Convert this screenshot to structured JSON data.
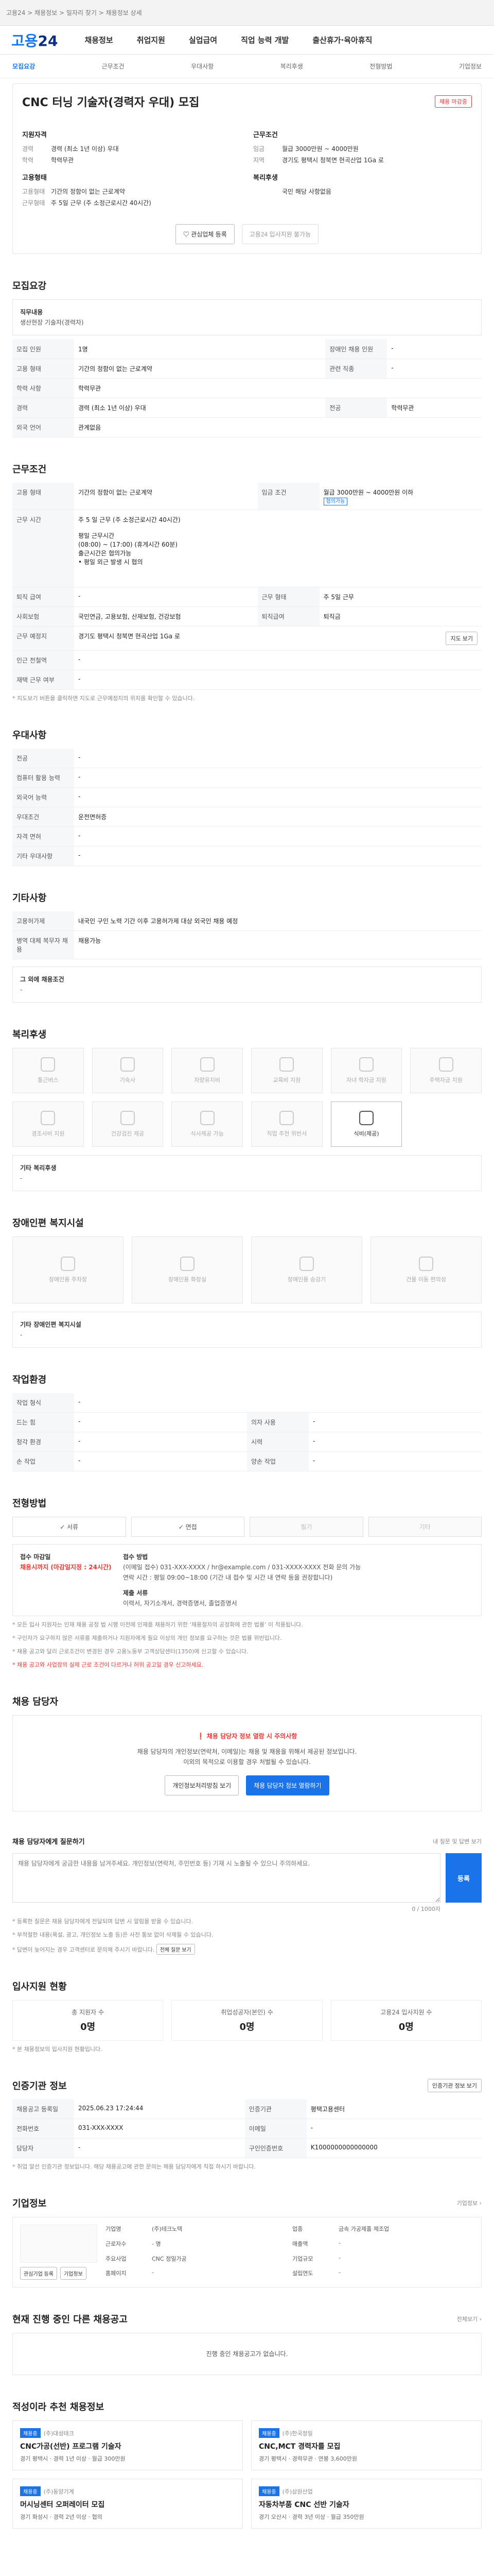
{
  "window_title": "고용24 > 채용정보 > 일자리 찾기 > 채용정보 상세",
  "brand": {
    "logo": "고용",
    "logo_num": "24"
  },
  "gnb": [
    "채용정보",
    "취업지원",
    "실업급여",
    "직업 능력 개발",
    "출산휴가·육아휴직"
  ],
  "subnav": [
    {
      "label": "모집요강",
      "active": true
    },
    {
      "label": "근무조건",
      "active": false
    },
    {
      "label": "우대사항",
      "active": false
    },
    {
      "label": "복리후생",
      "active": false
    },
    {
      "label": "전형방법",
      "active": false
    },
    {
      "label": "기업정보",
      "active": false
    }
  ],
  "job": {
    "title": "CNC 터닝 기술자(경력자 우대) 모집",
    "badge": "채용 마감중",
    "left_head": "지원자격",
    "left_rows": [
      {
        "k": "경력",
        "v": "경력 (최소 1년 이상) 우대"
      },
      {
        "k": "학력",
        "v": "학력무관"
      }
    ],
    "left_head2": "고용형태",
    "left_rows2": [
      {
        "k": "고용형태",
        "v": "기간의 정함이 없는 근로계약"
      },
      {
        "k": "근무형태",
        "v": "주 5일 근무 (주 소정근로시간 40시간)"
      }
    ],
    "right_head": "근무조건",
    "right_rows": [
      {
        "k": "임금",
        "v": "월급 3000만원 ~ 4000만원"
      },
      {
        "k": "지역",
        "v": "경기도 평택시 청북면 현곡산업 1Ga 로"
      }
    ],
    "right_head2": "복리후생",
    "right_rows2": [
      {
        "k": "",
        "v": "국민 해당 사항없음"
      }
    ],
    "btn_apply": "관심업체 등록",
    "btn_scrap": "고용24 입사지원 불가능"
  },
  "recruit": {
    "title": "모집요강",
    "desc_label": "직무내용",
    "desc": "생산현장 기술자(경력자)",
    "rows": [
      {
        "k1": "모집 인원",
        "v1": "1명",
        "k2": "장애인 채용 인원",
        "v2": "-"
      },
      {
        "k1": "고용 형태",
        "v1": "기간의 정함이 없는 근로계약",
        "k2": "관련 직종",
        "v2": "-"
      },
      {
        "k1": "학력 사항",
        "v1": "학력무관",
        "k2": "",
        "v2": ""
      },
      {
        "k1": "경력",
        "v1": "경력 (최소 1년 이상) 우대",
        "k2": "전공",
        "v2": "학력무관"
      },
      {
        "k1": "외국 언어",
        "v1": "관계없음",
        "k2": "",
        "v2": ""
      }
    ]
  },
  "condition": {
    "title": "근무조건",
    "rows": [
      {
        "k1": "고용 형태",
        "v1": "기간의 정함이 없는 근로계약",
        "k2": "임금 조건",
        "v2": "월급 3000만원 ~ 4000만원 이하",
        "tag": "협의가능"
      },
      {
        "k1": "근무 시간",
        "v1": "주 5 일 근무 (주 소정근로시간 40시간)\n\n평일 근무시간\n(08:00) ~ (17:00) (휴게시간 60분)\n출근시간은 협의가능\n• 평일 외근 발생 시 협의",
        "k2": "",
        "v2": ""
      },
      {
        "k1": "퇴직 급여",
        "v1": "-",
        "k2": "근무 형태",
        "v2": "주 5일 근무"
      },
      {
        "k1": "사회보험",
        "v1": "국민연금, 고용보험, 산재보험, 건강보험",
        "k2": "퇴직급여",
        "v2": "퇴직금"
      },
      {
        "k1": "근무 예정지",
        "v1": "경기도 평택시 청북면 현곡산업 1Ga 로",
        "k2": "",
        "v2": ""
      },
      {
        "k1": "인근 전철역",
        "v1": "-",
        "k2": "",
        "v2": ""
      },
      {
        "k1": "재택 근무 여부",
        "v1": "-",
        "k2": "",
        "v2": ""
      }
    ],
    "map_btn": "지도 보기",
    "note": "* 지도보기 버튼을 클릭하면 지도로 근무예정지의 위치를 확인할 수 있습니다."
  },
  "preference": {
    "title": "우대사항",
    "rows": [
      {
        "k": "전공",
        "v": "-"
      },
      {
        "k": "컴퓨터 활용 능력",
        "v": "-"
      },
      {
        "k": "외국어 능력",
        "v": "-"
      },
      {
        "k": "우대조건",
        "v": "운전면허증"
      },
      {
        "k": "자격 면허",
        "v": "-"
      },
      {
        "k": "기타 우대사항",
        "v": "-"
      }
    ]
  },
  "etc": {
    "title": "기타사항",
    "rows": [
      {
        "k": "고용허가제",
        "v": "내국인 구인 노력 기간 이후 고용허가제 대상 외국인 채용 예정"
      },
      {
        "k": "병역 대체 복무자 채용",
        "v": "채용가능"
      }
    ],
    "other_label": "그 외에 채용조건",
    "other_value": "-"
  },
  "welfare": {
    "title": "복리후생",
    "items": [
      {
        "label": "통근버스",
        "on": false
      },
      {
        "label": "기숙사",
        "on": false
      },
      {
        "label": "차량유지비",
        "on": false
      },
      {
        "label": "교육비 지원",
        "on": false
      },
      {
        "label": "자녀 학자금 지원",
        "on": false
      },
      {
        "label": "주택자금 지원",
        "on": false
      },
      {
        "label": "경조사비 지원",
        "on": false
      },
      {
        "label": "건강검진 제공",
        "on": false
      },
      {
        "label": "식사제공 가능",
        "on": false
      },
      {
        "label": "직업 추천 위반서",
        "on": false
      },
      {
        "label": "식비(제공)",
        "on": true
      }
    ],
    "other_label": "기타 복리후생",
    "other_value": "-"
  },
  "disability": {
    "title": "장애인편 복지시설",
    "items": [
      "장애인용 주차장",
      "장애인용 화장실",
      "장애인용 승강기",
      "건물 이동 편의성"
    ],
    "other_label": "기타 장애인편 복지시설",
    "other_value": "-"
  },
  "work_env": {
    "title": "작업환경",
    "rows": [
      {
        "k1": "작업 형식",
        "v1": "-",
        "k2": "",
        "v2": ""
      },
      {
        "k1": "드는 힘",
        "v1": "-",
        "k2": "의자 사용",
        "v2": "-"
      },
      {
        "k1": "청각 환경",
        "v1": "-",
        "k2": "시력",
        "v2": "-"
      },
      {
        "k1": "손 작업",
        "v1": "-",
        "k2": "양손 작업",
        "v2": "-"
      }
    ]
  },
  "process": {
    "title": "전형방법",
    "methods": [
      {
        "label": "서류",
        "on": true
      },
      {
        "label": "면접",
        "on": true
      },
      {
        "label": "필기",
        "on": false
      },
      {
        "label": "기타",
        "on": false
      }
    ],
    "deadline_label": "접수 마감일",
    "deadline_value": "채용시까지 (마감일지정 : 24시간)",
    "apply_label": "접수 방법",
    "apply_value": "(이메일 접수) 031-XXX-XXXX / hr@example.com / 031-XXXX-XXXX 전화 문의 가능\n연락 시간 : 평일 09:00~18:00 (기간 내 접수 및 시간 내 연락 등을 권장합니다)",
    "doc_label": "제출 서류",
    "doc_value": "이력서, 자기소개서, 경력증명서, 졸업증명서",
    "notes": [
      "* 모든 입사 지원자는 인재 채용 공정 법 시행 이전에 인재를 채용하기 위한 ‘채용절차의 공정화에 관한 법률’ 이 적용됩니다.",
      "* 구인자가 요구하지 않은 서류를 제출하거나 지원자에게 필요 이상의 개인 정보를 요구하는 것은 법률 위반입니다.",
      "* 채용 공고와 달리 근로조건이 변경된 경우 고용노동부 고객상담센터(1350)에 신고할 수 있습니다."
    ],
    "red_note": "* 채용 공고와 사업장의 실제 근로 조건이 다르거나 허위 공고일 경우 신고하세요."
  },
  "contact": {
    "title": "채용 담당자",
    "msg_title": "채용 담당자 정보 열람 시 주의사항",
    "msg_line1": "채용 담당자의 개인정보(연락처, 이메일)는 채용 및 채용을 위해서 제공된 정보입니다.",
    "msg_line2": "이외의 목적으로 이용할 경우 처벌될 수 있습니다.",
    "btn_check": "개인정보처리방침 보기",
    "btn_view": "채용 담당자 정보 열람하기"
  },
  "qna": {
    "title": "채용 담당자에게 질문하기",
    "counter_note": "내 질문 및 답변 보기",
    "placeholder": "채용 담당자에게 궁금한 내용을 남겨주세요. 개인정보(연락처, 주민번호 등) 기재 시 노출될 수 있으니 주의하세요.",
    "submit": "등록",
    "char_count": "0 / 1000자",
    "notes": [
      "* 등록한 질문은 채용 담당자에게 전달되며 답변 시 알림을 받을 수 있습니다.",
      "* 부적절한 내용(욕설, 광고, 개인정보 노출 등)은 사전 통보 없이 삭제될 수 있습니다.",
      "* 답변이 늦어지는 경우 고객센터로 문의해 주시기 바랍니다."
    ],
    "extra_btn": "전체 질문 보기"
  },
  "status": {
    "title": "입사지원 현황",
    "items": [
      {
        "label": "총 지원자 수",
        "value": "0명"
      },
      {
        "label": "취업성공자(본인) 수",
        "value": "0명"
      },
      {
        "label": "고용24 입사지원 수",
        "value": "0명"
      }
    ],
    "note": "* 본 채용정보의 입사지원 현황입니다."
  },
  "manager": {
    "title": "인증기관 정보",
    "btn_share": "인증기관 정보 보기",
    "rows": [
      {
        "k1": "채용공고 등록일",
        "v1": "2025.06.23 17:24:44",
        "k2": "인증기관",
        "v2": "평택고용센터"
      },
      {
        "k1": "전화번호",
        "v1": "031-XXX-XXXX",
        "k2": "이메일",
        "v2": "-"
      },
      {
        "k1": "담당자",
        "v1": "-",
        "k2": "구인인증번호",
        "v2": "K1000000000000000"
      }
    ],
    "notes": [
      "* 취업 알선 인증기관 정보입니다. 해당 채용공고에 관한 문의는 채용 담당자에게 직접 하시기 바랍니다."
    ]
  },
  "company": {
    "title": "기업정보",
    "link": "기업정보 ›",
    "btn1": "관심기업 등록",
    "btn2": "기업정보",
    "info": [
      {
        "k": "기업명",
        "v": "(주)테크노텍"
      },
      {
        "k": "업종",
        "v": "금속 가공제품 제조업"
      },
      {
        "k": "근로자수",
        "v": "- 명"
      },
      {
        "k": "매출액",
        "v": "-"
      },
      {
        "k": "주요사업",
        "v": "CNC 정밀가공"
      },
      {
        "k": "기업규모",
        "v": "-"
      },
      {
        "k": "홈페이지",
        "v": "-"
      },
      {
        "k": "설립연도",
        "v": "-"
      }
    ]
  },
  "other_jobs": {
    "title": "현재 진행 중인 다른 채용공고",
    "link": "전체보기 ›",
    "empty": "진행 중인 채용공고가 없습니다."
  },
  "recommend": {
    "title": "적성이라 추천 채용정보",
    "items": [
      {
        "tag": "채용중",
        "company": "(주)대성테크",
        "title": "CNC가공(선반) 프로그램 기술자",
        "meta": "경기 평택시 · 경력 1년 이상 · 월급 300만원"
      },
      {
        "tag": "채용중",
        "company": "(주)한국정밀",
        "title": "CNC,MCT 경력자를 모집",
        "meta": "경기 평택시 · 경력무관 · 연봉 3,600만원"
      },
      {
        "tag": "채용중",
        "company": "(주)동양기계",
        "title": "머시닝센터 오퍼레이터 모집",
        "meta": "경기 화성시 · 경력 2년 이상 · 협의"
      },
      {
        "tag": "채용중",
        "company": "(주)삼원산업",
        "title": "자동차부품 CNC 선반 기술자",
        "meta": "경기 오산시 · 경력 3년 이상 · 월급 350만원"
      }
    ]
  }
}
